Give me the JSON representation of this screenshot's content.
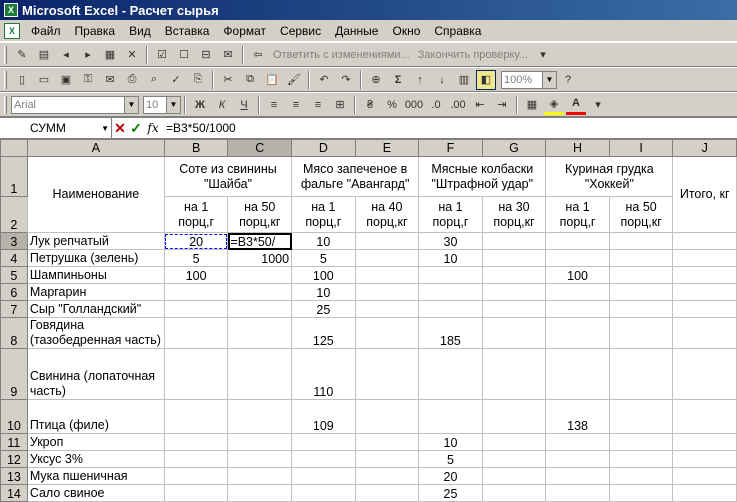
{
  "window": {
    "title": "Microsoft Excel - Расчет сырья"
  },
  "menu": [
    "Файл",
    "Правка",
    "Вид",
    "Вставка",
    "Формат",
    "Сервис",
    "Данные",
    "Окно",
    "Справка"
  ],
  "review_toolbar": {
    "reply": "Ответить с изменениями...",
    "end_review": "Закончить проверку..."
  },
  "standard_toolbar": {
    "zoom": "100%"
  },
  "format_toolbar": {
    "font": "Arial",
    "size": "10"
  },
  "formula_bar": {
    "name_box": "СУММ",
    "formula": "=B3*50/1000"
  },
  "columns": [
    "A",
    "B",
    "C",
    "D",
    "E",
    "F",
    "G",
    "H",
    "I",
    "J"
  ],
  "rows": [
    "1",
    "2",
    "3",
    "4",
    "5",
    "6",
    "7",
    "8",
    "9",
    "10",
    "11",
    "12",
    "13",
    "14"
  ],
  "header": {
    "name": "Наименование",
    "g1": "Соте из свинины \"Шайба\"",
    "g2": "Мясо запеченое в фальге \"Авангард\"",
    "g3": "Мясные колбаски \"Штрафной удар\"",
    "g4": "Куриная грудка \"Хоккей\"",
    "total": "Итого, кг",
    "sub": [
      "на 1 порц,г",
      "на 50 порц,кг",
      "на 1 порц,г",
      "на 40 порц,кг",
      "на 1 порц,г",
      "на 30 порц,кг",
      "на 1 порц,г",
      "на 50 порц,кг"
    ]
  },
  "data": [
    {
      "name": "Лук репчатый",
      "b": "20",
      "c": "=B3*50/",
      "d": "10",
      "e": "",
      "f": "30",
      "g": "",
      "h": "",
      "i": "",
      "j": ""
    },
    {
      "name": "Петрушка (зелень)",
      "b": "5",
      "c": "1000",
      "d": "5",
      "e": "",
      "f": "10",
      "g": "",
      "h": "",
      "i": "",
      "j": ""
    },
    {
      "name": "Шампиньоны",
      "b": "100",
      "c": "",
      "d": "100",
      "e": "",
      "f": "",
      "g": "",
      "h": "100",
      "i": "",
      "j": ""
    },
    {
      "name": "Маргарин",
      "b": "",
      "c": "",
      "d": "10",
      "e": "",
      "f": "",
      "g": "",
      "h": "",
      "i": "",
      "j": ""
    },
    {
      "name": "Сыр \"Голландский\"",
      "b": "",
      "c": "",
      "d": "25",
      "e": "",
      "f": "",
      "g": "",
      "h": "",
      "i": "",
      "j": ""
    },
    {
      "name": "Говядина (тазобедренная часть)",
      "b": "",
      "c": "",
      "d": "125",
      "e": "",
      "f": "185",
      "g": "",
      "h": "",
      "i": "",
      "j": ""
    },
    {
      "name": "Свинина (лопаточная часть)",
      "b": "",
      "c": "",
      "d": "110",
      "e": "",
      "f": "",
      "g": "",
      "h": "",
      "i": "",
      "j": ""
    },
    {
      "name": "Птица (филе)",
      "b": "",
      "c": "",
      "d": "109",
      "e": "",
      "f": "",
      "g": "",
      "h": "138",
      "i": "",
      "j": ""
    },
    {
      "name": "Укроп",
      "b": "",
      "c": "",
      "d": "",
      "e": "",
      "f": "10",
      "g": "",
      "h": "",
      "i": "",
      "j": ""
    },
    {
      "name": "Уксус 3%",
      "b": "",
      "c": "",
      "d": "",
      "e": "",
      "f": "5",
      "g": "",
      "h": "",
      "i": "",
      "j": ""
    },
    {
      "name": "Мука пшеничная",
      "b": "",
      "c": "",
      "d": "",
      "e": "",
      "f": "20",
      "g": "",
      "h": "",
      "i": "",
      "j": ""
    },
    {
      "name": "Сало свиное",
      "b": "",
      "c": "",
      "d": "",
      "e": "",
      "f": "25",
      "g": "",
      "h": "",
      "i": "",
      "j": ""
    }
  ]
}
